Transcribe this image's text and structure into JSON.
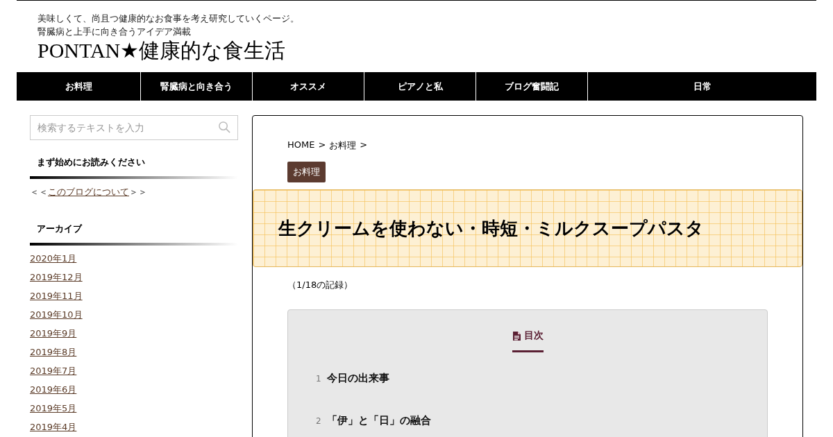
{
  "header": {
    "tagline_lines": [
      "美味しくて、尚且つ健康的なお食事を考え研究していくページ。",
      "腎臓病と上手に向き合うアイデア満載"
    ],
    "site_title": "PONTAN★健康的な食生活"
  },
  "nav": [
    {
      "label": "お料理"
    },
    {
      "label": "腎臓病と向き合う"
    },
    {
      "label": "オススメ"
    },
    {
      "label": "ピアノと私"
    },
    {
      "label": "ブログ奮闘記"
    },
    {
      "label": "日常"
    }
  ],
  "sidebar": {
    "search": {
      "placeholder": "検索するテキストを入力"
    },
    "intro": {
      "heading": "まず始めにお読みください",
      "prefix": "＜＜",
      "link": "このブログについて",
      "suffix": "＞＞"
    },
    "archive": {
      "heading": "アーカイブ",
      "items": [
        "2020年1月",
        "2019年12月",
        "2019年11月",
        "2019年10月",
        "2019年9月",
        "2019年8月",
        "2019年7月",
        "2019年6月",
        "2019年5月",
        "2019年4月"
      ]
    }
  },
  "article": {
    "breadcrumb": [
      {
        "label": "HOME",
        "separator": ">"
      },
      {
        "label": "お料理",
        "separator": ">"
      }
    ],
    "category": "お料理",
    "title": "生クリームを使わない・時短・ミルクスープパスタ",
    "record": "（1/18の記録）",
    "toc": {
      "title": "目次",
      "items": [
        {
          "number": "1",
          "label": "今日の出来事"
        },
        {
          "number": "2",
          "label": "「伊」と「日」の融合"
        }
      ]
    }
  }
}
